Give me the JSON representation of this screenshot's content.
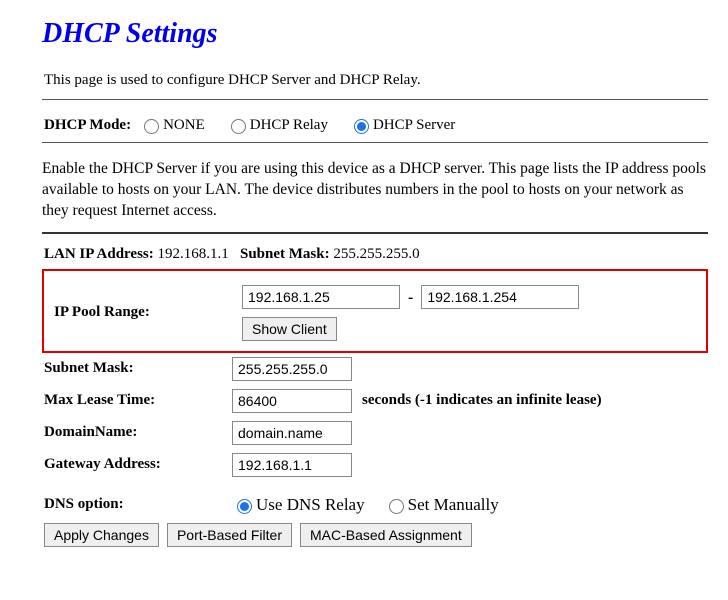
{
  "title": "DHCP Settings",
  "intro": "This page is used to configure DHCP Server and DHCP Relay.",
  "mode": {
    "label": "DHCP Mode:",
    "options": {
      "none": "NONE",
      "relay": "DHCP Relay",
      "server": "DHCP Server"
    },
    "selected": "server"
  },
  "description": "Enable the DHCP Server if you are using this device as a DHCP server. This page lists the IP address pools available to hosts on your LAN. The device distributes numbers in the pool to hosts on your network as they request Internet access.",
  "lan": {
    "ip_label": "LAN IP Address:",
    "ip_value": "192.168.1.1",
    "mask_label": "Subnet Mask:",
    "mask_value": "255.255.255.0"
  },
  "pool": {
    "label": "IP Pool Range:",
    "start": "192.168.1.25",
    "end": "192.168.1.254",
    "show_client": "Show Client"
  },
  "subnet": {
    "label": "Subnet Mask:",
    "value": "255.255.255.0"
  },
  "lease": {
    "label": "Max Lease Time:",
    "value": "86400",
    "suffix": "seconds (-1 indicates an infinite lease)"
  },
  "domain": {
    "label": "DomainName:",
    "value": "domain.name"
  },
  "gateway": {
    "label": "Gateway Address:",
    "value": "192.168.1.1"
  },
  "dns": {
    "label": "DNS option:",
    "relay": "Use DNS Relay",
    "manual": "Set Manually",
    "selected": "relay"
  },
  "buttons": {
    "apply": "Apply Changes",
    "port_filter": "Port-Based Filter",
    "mac_assign": "MAC-Based Assignment"
  }
}
